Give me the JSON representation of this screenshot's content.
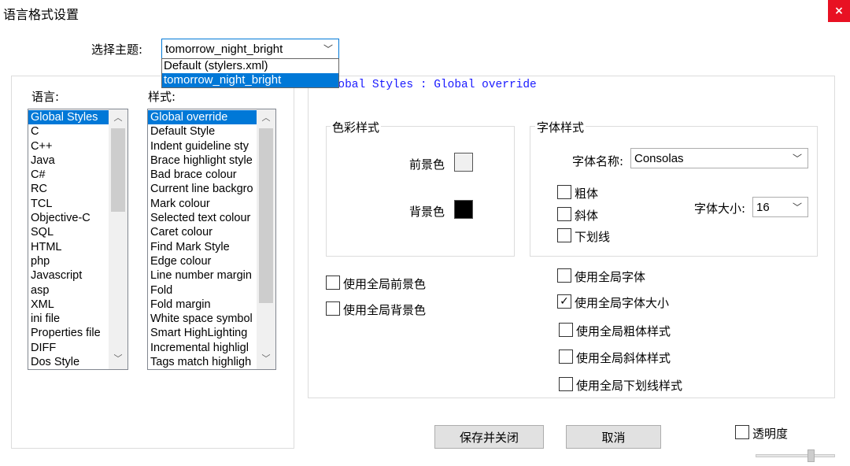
{
  "window": {
    "title": "语言格式设置",
    "close_glyph": "×"
  },
  "theme": {
    "label": "选择主题:",
    "selected": "tomorrow_night_bright",
    "options": [
      "Default (stylers.xml)",
      "tomorrow_night_bright"
    ]
  },
  "language_panel": {
    "label": "语言:",
    "items": [
      "Global Styles",
      "C",
      "C++",
      "Java",
      "C#",
      "RC",
      "TCL",
      "Objective-C",
      "SQL",
      "HTML",
      "php",
      "Javascript",
      "asp",
      "XML",
      "ini file",
      "Properties file",
      "DIFF",
      "Dos Style"
    ],
    "selected_index": 0
  },
  "style_panel": {
    "label": "样式:",
    "items": [
      "Global override",
      "Default Style",
      "Indent guideline sty",
      "Brace highlight style",
      "Bad brace colour",
      "Current line backgro",
      "Mark colour",
      "Selected text colour",
      "Caret colour",
      "Find Mark Style",
      "Edge colour",
      "Line number margin",
      "Fold",
      "Fold margin",
      "White space symbol",
      "Smart HighLighting",
      "Incremental highligl",
      "Tags match highligh"
    ],
    "selected_index": 0
  },
  "header_text": "Global Styles : Global override",
  "color_group": {
    "title": "色彩样式",
    "fg_label": "前景色",
    "bg_label": "背景色",
    "fg_color": "#f0f0f0",
    "bg_color": "#000000"
  },
  "font_group": {
    "title": "字体样式",
    "font_name_label": "字体名称:",
    "font_name": "Consolas",
    "bold_label": "粗体",
    "italic_label": "斜体",
    "underline_label": "下划线",
    "font_size_label": "字体大小:",
    "font_size": "16"
  },
  "global_options": {
    "use_global_fg": "使用全局前景色",
    "use_global_bg": "使用全局背景色",
    "use_global_font": "使用全局字体",
    "use_global_font_size": "使用全局字体大小",
    "use_global_bold": "使用全局粗体样式",
    "use_global_italic": "使用全局斜体样式",
    "use_global_underline": "使用全局下划线样式",
    "check_glyph": "✓"
  },
  "buttons": {
    "save_close": "保存并关闭",
    "cancel": "取消"
  },
  "transparency": {
    "label": "透明度"
  },
  "icons": {
    "chevron_down": "﹀",
    "arrow_up": "︿",
    "arrow_down": "﹀"
  }
}
